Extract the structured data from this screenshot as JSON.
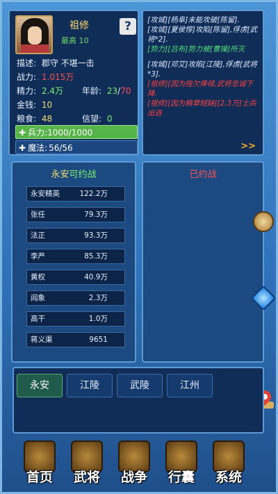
{
  "character": {
    "name": "祖修",
    "rank": "最高 10",
    "help_label": "?",
    "description_label": "描述:",
    "description": "郡守 不堪一击",
    "force_label": "战力:",
    "force_value": "1.015万",
    "energy_label": "精力:",
    "energy_value": "2.4万",
    "age_label": "年龄:",
    "age_current": "23",
    "age_max": "70",
    "gold_label": "金钱:",
    "gold_value": "10",
    "food_label": "粮食:",
    "food_value": "48",
    "prestige_label": "信望:",
    "prestige_value": "0",
    "troops_label": "兵力:",
    "troops_value": "1000/1000",
    "troops_fill": 1.0,
    "magic_label": "魔法:",
    "magic_value": "56/56"
  },
  "log": {
    "lines": [
      {
        "text": "[攻城][杨阜]未能攻破[陈留].",
        "color": "normal"
      },
      {
        "text": "[攻城][夏侯惇]攻陷[陈留],俘虏[武将*2].",
        "color": "normal"
      },
      {
        "text": "[势力][吕布]势力被[曹操]所灭",
        "color": "green"
      },
      {
        "text": "",
        "color": "gap"
      },
      {
        "text": "[攻城][邓艾]攻陷[江陵],俘虏[武将*3].",
        "color": "normal"
      },
      {
        "text": "[祖修][因为拖欠俸禄,武将忠诚下降.",
        "color": "red"
      },
      {
        "text": "[祖修][因为粮草短缺][2.3万]士兵出逃",
        "color": "red"
      }
    ],
    "more_label": ">>"
  },
  "available": {
    "city": "永安",
    "status": "可约战",
    "rows": [
      {
        "name": "永安精英",
        "value": "122.2万"
      },
      {
        "name": "张任",
        "value": "79.3万"
      },
      {
        "name": "法正",
        "value": "93.3万"
      },
      {
        "name": "李严",
        "value": "85.3万"
      },
      {
        "name": "黄权",
        "value": "40.9万"
      },
      {
        "name": "阎象",
        "value": "2.3万"
      },
      {
        "name": "高干",
        "value": "1.0万"
      },
      {
        "name": "蒋义渠",
        "value": "9651"
      }
    ]
  },
  "promised": {
    "title": "已约战"
  },
  "cities": [
    {
      "label": "永安",
      "active": true
    },
    {
      "label": "江陵",
      "active": false
    },
    {
      "label": "武陵",
      "active": false
    },
    {
      "label": "江州",
      "active": false
    }
  ],
  "nav": [
    {
      "label": "首页",
      "icon": "home-icon"
    },
    {
      "label": "武将",
      "icon": "general-icon"
    },
    {
      "label": "战争",
      "icon": "crossed-swords-icon"
    },
    {
      "label": "行囊",
      "icon": "bag-icon"
    },
    {
      "label": "系统",
      "icon": "system-chest-icon"
    }
  ],
  "colors": {
    "accent_green": "#56b548",
    "panel_bg": "#0f2d56",
    "highlight_yellow": "#ffd86a"
  }
}
